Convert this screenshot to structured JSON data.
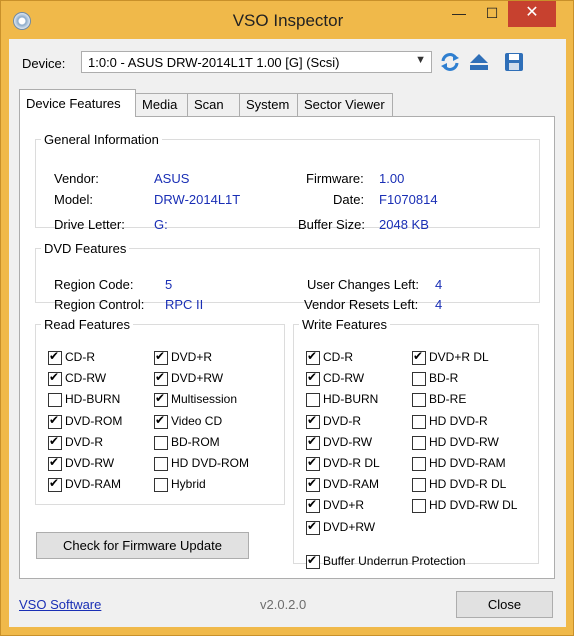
{
  "window": {
    "title": "VSO Inspector",
    "minimize": "—",
    "maximize": "☐",
    "close": "✕"
  },
  "device": {
    "label": "Device:",
    "selected": "1:0:0 - ASUS DRW-2014L1T 1.00 [G] (Scsi)"
  },
  "tabs": [
    {
      "label": "Device Features",
      "active": true
    },
    {
      "label": "Media"
    },
    {
      "label": "Scan"
    },
    {
      "label": "System"
    },
    {
      "label": "Sector Viewer"
    }
  ],
  "general": {
    "title": "General Information",
    "vendor_label": "Vendor:",
    "vendor": "ASUS",
    "model_label": "Model:",
    "model": "DRW-2014L1T",
    "drive_letter_label": "Drive Letter:",
    "drive_letter": "G:",
    "firmware_label": "Firmware:",
    "firmware": "1.00",
    "date_label": "Date:",
    "date": "F1070814",
    "buffer_label": "Buffer Size:",
    "buffer": "2048 KB"
  },
  "dvd": {
    "title": "DVD Features",
    "region_code_label": "Region Code:",
    "region_code": "5",
    "region_control_label": "Region Control:",
    "region_control": "RPC II",
    "user_changes_label": "User Changes Left:",
    "user_changes": "4",
    "vendor_resets_label": "Vendor Resets Left:",
    "vendor_resets": "4"
  },
  "read": {
    "title": "Read Features",
    "col1": [
      {
        "label": "CD-R",
        "checked": true
      },
      {
        "label": "CD-RW",
        "checked": true
      },
      {
        "label": "HD-BURN",
        "checked": false
      },
      {
        "label": "DVD-ROM",
        "checked": true
      },
      {
        "label": "DVD-R",
        "checked": true
      },
      {
        "label": "DVD-RW",
        "checked": true
      },
      {
        "label": "DVD-RAM",
        "checked": true
      }
    ],
    "col2": [
      {
        "label": "DVD+R",
        "checked": true
      },
      {
        "label": "DVD+RW",
        "checked": true
      },
      {
        "label": "Multisession",
        "checked": true
      },
      {
        "label": "Video CD",
        "checked": true
      },
      {
        "label": "BD-ROM",
        "checked": false
      },
      {
        "label": "HD DVD-ROM",
        "checked": false
      },
      {
        "label": "Hybrid",
        "checked": false
      }
    ]
  },
  "write": {
    "title": "Write Features",
    "col1": [
      {
        "label": "CD-R",
        "checked": true
      },
      {
        "label": "CD-RW",
        "checked": true
      },
      {
        "label": "HD-BURN",
        "checked": false
      },
      {
        "label": "DVD-R",
        "checked": true
      },
      {
        "label": "DVD-RW",
        "checked": true
      },
      {
        "label": "DVD-R DL",
        "checked": true
      },
      {
        "label": "DVD-RAM",
        "checked": true
      },
      {
        "label": "DVD+R",
        "checked": true
      },
      {
        "label": "DVD+RW",
        "checked": true
      }
    ],
    "col2": [
      {
        "label": "DVD+R DL",
        "checked": true
      },
      {
        "label": "BD-R",
        "checked": false
      },
      {
        "label": "BD-RE",
        "checked": false
      },
      {
        "label": "HD DVD-R",
        "checked": false
      },
      {
        "label": "HD DVD-RW",
        "checked": false
      },
      {
        "label": "HD DVD-RAM",
        "checked": false
      },
      {
        "label": "HD DVD-R DL",
        "checked": false
      },
      {
        "label": "HD DVD-RW DL",
        "checked": false
      }
    ],
    "buffer_underrun": {
      "label": "Buffer Underrun Protection",
      "checked": true
    }
  },
  "firmware_button": "Check for Firmware Update",
  "footer": {
    "link": "VSO Software",
    "version": "v2.0.2.0",
    "close": "Close"
  },
  "colors": {
    "frame": "#f0b94a",
    "value_text": "#1a2fb5",
    "close_button": "#c7412f"
  }
}
